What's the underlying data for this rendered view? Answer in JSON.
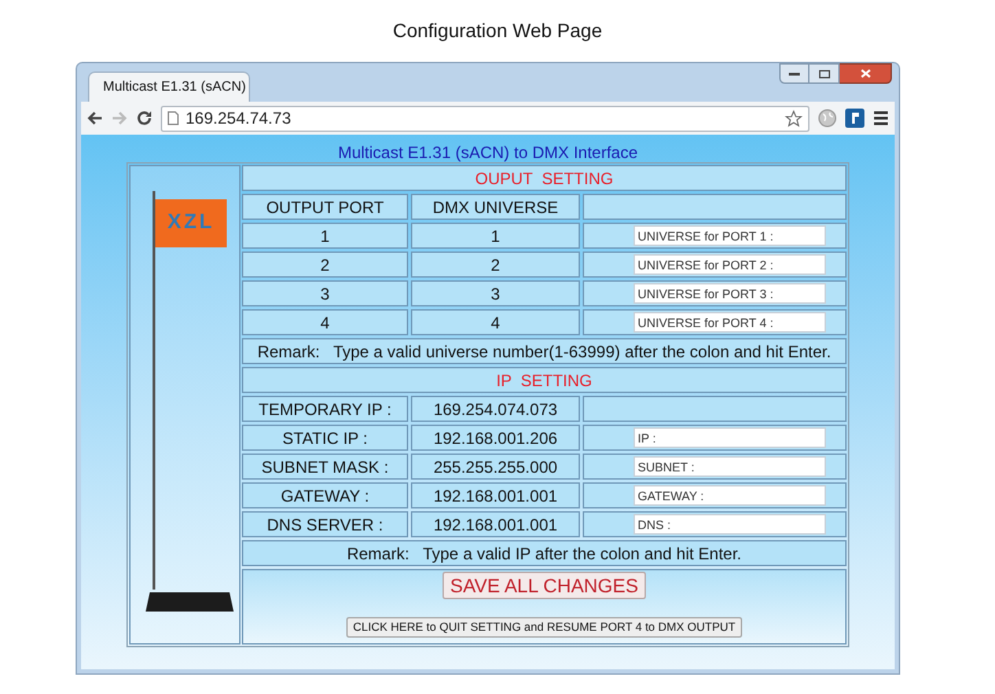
{
  "caption": "Configuration Web Page",
  "browser": {
    "tab": {
      "title": "Multicast E1.31 (sACN)"
    },
    "address": "169.254.74.73",
    "forward_disabled": true
  },
  "page": {
    "heading": "Multicast E1.31 (sACN) to DMX Interface",
    "logo": "XZL",
    "output_setting": {
      "title": "OUPUT  SETTING",
      "columns": [
        "OUTPUT PORT",
        "DMX UNIVERSE"
      ],
      "rows": [
        {
          "port": "1",
          "universe": "1",
          "input": "UNIVERSE for PORT 1 :"
        },
        {
          "port": "2",
          "universe": "2",
          "input": "UNIVERSE for PORT 2 :"
        },
        {
          "port": "3",
          "universe": "3",
          "input": "UNIVERSE for PORT 3 :"
        },
        {
          "port": "4",
          "universe": "4",
          "input": "UNIVERSE for PORT 4 :"
        }
      ],
      "remark": "Remark:   Type a valid universe number(1-63999) after the colon and hit Enter."
    },
    "ip_setting": {
      "title": "IP  SETTING",
      "rows": [
        {
          "label": "TEMPORARY IP :",
          "value": "169.254.074.073"
        },
        {
          "label": "STATIC IP :",
          "value": "192.168.001.206",
          "input": "IP :"
        },
        {
          "label": "SUBNET MASK :",
          "value": "255.255.255.000",
          "input": "SUBNET :"
        },
        {
          "label": "GATEWAY :",
          "value": "192.168.001.001",
          "input": "GATEWAY :"
        },
        {
          "label": "DNS SERVER :",
          "value": "192.168.001.001",
          "input": "DNS :"
        }
      ],
      "remark": "Remark:   Type a valid IP after the colon and hit Enter."
    },
    "buttons": {
      "save": "SAVE ALL CHANGES",
      "quit": "CLICK HERE to QUIT SETTING and RESUME PORT 4 to DMX OUTPUT"
    }
  }
}
